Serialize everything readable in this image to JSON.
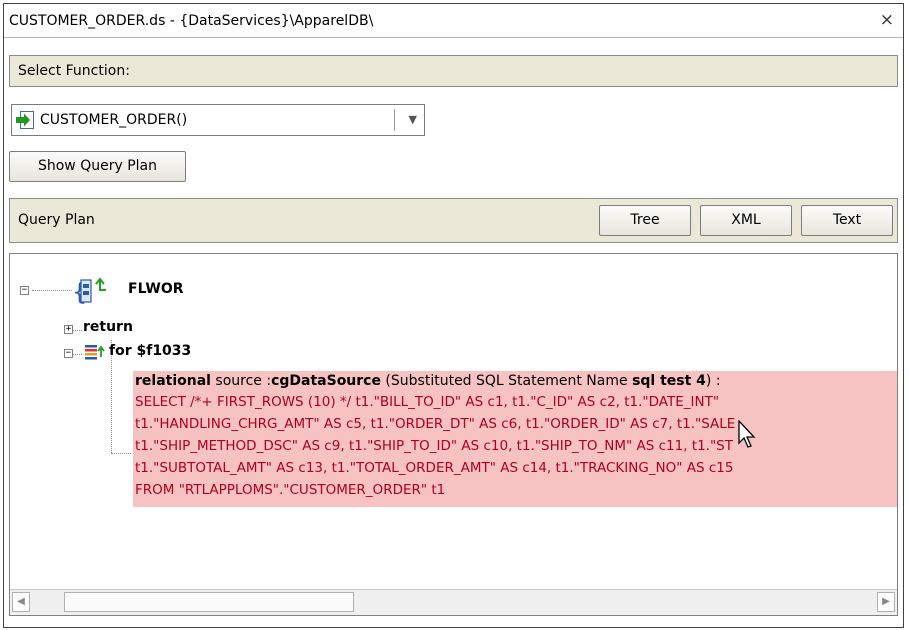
{
  "window": {
    "title": "CUSTOMER_ORDER.ds - {DataServices}\\ApparelDB\\",
    "close_glyph": "×"
  },
  "select_function": {
    "label": "Select Function:",
    "combo_value": "CUSTOMER_ORDER()",
    "icon": "function-arrow-icon"
  },
  "buttons": {
    "show_query_plan": "Show Query Plan"
  },
  "query_plan": {
    "label": "Query Plan",
    "view_tabs": [
      "Tree",
      "XML",
      "Text"
    ]
  },
  "tree": {
    "root_label": "FLWOR",
    "return_label": "return",
    "for_label": "for $f1033",
    "relational": {
      "keyword": "relational",
      "source_text": " source :",
      "source_name": "cgDataSource",
      "substituted_text": " (Substituted SQL Statement Name ",
      "statement_name": "sql test 4",
      "closing": ") :"
    },
    "sql_lines": [
      "SELECT /*+ FIRST_ROWS (10) */ t1.\"BILL_TO_ID\" AS c1, t1.\"C_ID\" AS c2, t1.\"DATE_INT\"",
      "t1.\"HANDLING_CHRG_AMT\" AS c5, t1.\"ORDER_DT\" AS c6, t1.\"ORDER_ID\" AS c7, t1.\"SALE",
      "t1.\"SHIP_METHOD_DSC\" AS c9, t1.\"SHIP_TO_ID\" AS c10, t1.\"SHIP_TO_NM\" AS c11, t1.\"ST",
      "t1.\"SUBTOTAL_AMT\" AS c13, t1.\"TOTAL_ORDER_AMT\" AS c14, t1.\"TRACKING_NO\" AS c15",
      "FROM \"RTLAPPLOMS\".\"CUSTOMER_ORDER\" t1"
    ]
  },
  "colors": {
    "section_bg": "#ece8d8",
    "sql_highlight": "#f6c2c2",
    "sql_text": "#b0001e"
  }
}
